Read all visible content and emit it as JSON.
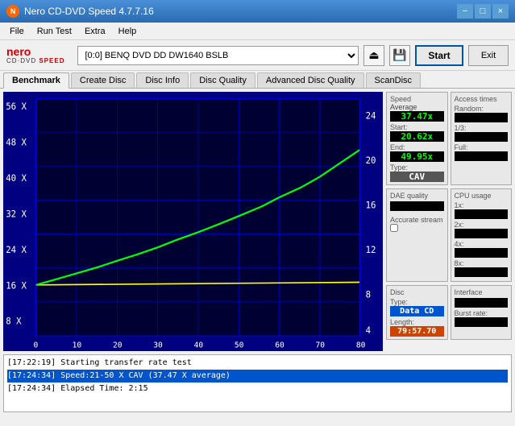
{
  "titlebar": {
    "title": "Nero CD-DVD Speed 4.7.7.16",
    "minimize": "−",
    "maximize": "□",
    "close": "×"
  },
  "menubar": {
    "items": [
      "File",
      "Run Test",
      "Extra",
      "Help"
    ]
  },
  "toolbar": {
    "drive_value": "[0:0]  BENQ DVD DD DW1640 BSLB",
    "start_label": "Start",
    "exit_label": "Exit"
  },
  "tabs": [
    {
      "label": "Benchmark",
      "active": true
    },
    {
      "label": "Create Disc"
    },
    {
      "label": "Disc Info"
    },
    {
      "label": "Disc Quality"
    },
    {
      "label": "Advanced Disc Quality"
    },
    {
      "label": "ScanDisc"
    }
  ],
  "speed": {
    "title": "Speed",
    "average_label": "Average",
    "average_value": "37.47x",
    "start_label": "Start:",
    "start_value": "20.62x",
    "end_label": "End:",
    "end_value": "49.95x",
    "type_label": "Type:",
    "type_value": "CAV"
  },
  "access_times": {
    "title": "Access times",
    "random_label": "Random:",
    "onethird_label": "1/3:",
    "full_label": "Full:"
  },
  "dae": {
    "title": "DAE quality",
    "accurate_stream_label": "Accurate stream"
  },
  "cpu_usage": {
    "title": "CPU usage",
    "labels": [
      "1x:",
      "2x:",
      "4x:",
      "8x:"
    ]
  },
  "disc": {
    "type_title": "Disc",
    "type_label": "Type:",
    "type_value": "Data CD",
    "length_label": "Length:",
    "length_value": "79:57.70"
  },
  "interface": {
    "title": "Interface",
    "burst_title": "Burst rate:"
  },
  "log": {
    "lines": [
      {
        "text": "[17:22:19]  Starting transfer rate test",
        "highlight": false
      },
      {
        "text": "[17:24:34]  Speed:21-50 X CAV (37.47 X average)",
        "highlight": true
      },
      {
        "text": "[17:24:34]  Elapsed Time: 2:15",
        "highlight": false
      }
    ]
  },
  "chart": {
    "y_left_labels": [
      "56 X",
      "48 X",
      "40 X",
      "32 X",
      "24 X",
      "16 X",
      "8 X"
    ],
    "y_right_labels": [
      "24",
      "20",
      "16",
      "12",
      "8",
      "4"
    ],
    "x_labels": [
      "0",
      "10",
      "20",
      "30",
      "40",
      "50",
      "60",
      "70",
      "80"
    ]
  }
}
